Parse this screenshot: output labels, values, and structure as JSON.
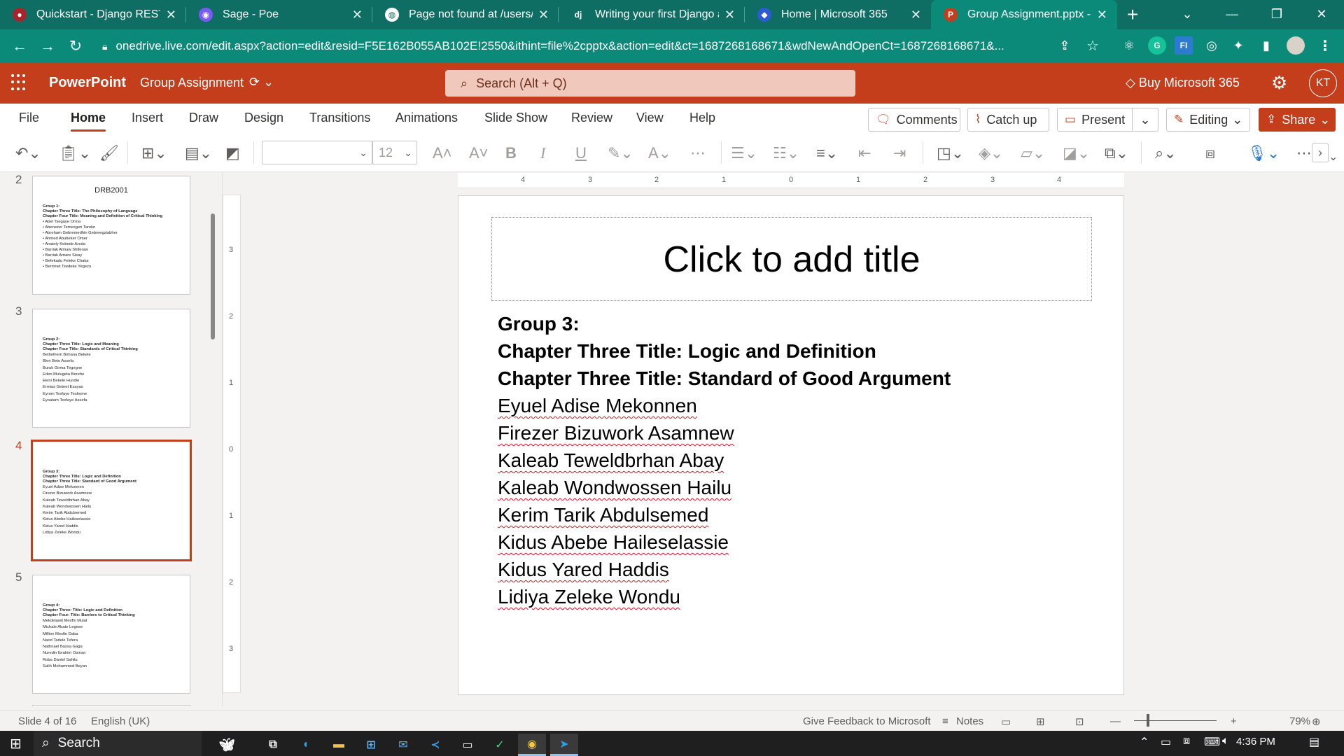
{
  "browser": {
    "tabs": [
      {
        "title": "Quickstart - Django REST fr",
        "favicon_color": "#a4262c",
        "favicon": "dj"
      },
      {
        "title": "Sage - Poe",
        "favicon_color": "#7a5af8",
        "favicon": "P"
      },
      {
        "title": "Page not found at /users/",
        "favicon_color": "#0f6e63",
        "favicon": "◍"
      },
      {
        "title": "Writing your first Django ap",
        "favicon_color": "#0c4b33",
        "favicon": "dj"
      },
      {
        "title": "Home | Microsoft 365",
        "favicon_color": "#2b5cd1",
        "favicon": "M"
      },
      {
        "title": "Group Assignment.pptx - M",
        "favicon_color": "#c43e1c",
        "favicon": "P"
      }
    ],
    "url": "onedrive.live.com/edit.aspx?action=edit&resid=F5E162B055AB102E!2550&ithint=file%2cpptx&action=edit&ct=1687268168671&wdNewAndOpenCt=1687268168671&..."
  },
  "office": {
    "app_name": "PowerPoint",
    "doc_name": "Group Assignment",
    "search_placeholder": "Search (Alt + Q)",
    "buy_label": "Buy Microsoft 365",
    "avatar_initials": "KT",
    "accent": "#c43e1c"
  },
  "ribbon": {
    "tabs": [
      "File",
      "Home",
      "Insert",
      "Draw",
      "Design",
      "Transitions",
      "Animations",
      "Slide Show",
      "Review",
      "View",
      "Help"
    ],
    "active_tab": "Home",
    "comments_label": "Comments",
    "catchup_label": "Catch up",
    "present_label": "Present",
    "editing_label": "Editing",
    "share_label": "Share",
    "font_size": "12"
  },
  "rulers": {
    "horizontal": [
      "4",
      "3",
      "2",
      "1",
      "0",
      "1",
      "2",
      "3",
      "4"
    ],
    "vertical": [
      "3",
      "2",
      "1",
      "0",
      "1",
      "2",
      "3"
    ]
  },
  "thumbnails": [
    {
      "number": "2",
      "title": "DRB2001",
      "bold_lines": [
        "Group 1:",
        "Chapter Three Title: The Philosophy of Language",
        "Chapter Four Title:  Meaning and Definition of Critical Thinking"
      ],
      "lines": [
        "•  Abel Tsegaye Orma",
        "•  Abenezer Temesgen Tarekn",
        "•  Abreham Gebremedhin Gebreegziabher",
        "•  Ahmed Abubeker Omer",
        "•  Anatoly Kebede Areda",
        "•  Barriak Almaw Shiferaw",
        "•  Barriak Amare Sisay",
        "•  Befekadu Feleke Chaka",
        "•  Bermnet Tsedeke Yegezu"
      ]
    },
    {
      "number": "3",
      "title": "",
      "bold_lines": [
        "Group 2:",
        "Chapter Three Title: Logic and Meaning",
        "Chapter Four Title: Standards of Critical Thinking"
      ],
      "lines": [
        "Bethelhem Birhanu Bekele",
        "Blen Beto Assefa",
        "Buruk Girma Tegegne",
        "Eden Mulugeta Berehe",
        "Eleni Bekele Hundie",
        "Ermias Getnet Esayas",
        "Eyrom Tesfaye Teshome",
        "Eyoatam Tesfaye Assefa"
      ]
    },
    {
      "number": "4",
      "title": "",
      "bold_lines": [
        "Group 3:",
        "Chapter Three Title: Logic and Definition",
        "Chapter Three Title: Standard of Good Argument"
      ],
      "lines": [
        "Eyuel Adise Mekonnen",
        "Firezer Bizuwork Asamnew",
        "Kaleab Teweldbrhan Abay",
        "Kaleab Wondwossen Hailu",
        "Kerim Tarik Abdulsemed",
        "Kidus Abebe Haileselassie",
        "Kidus Yared Haddis",
        "Lidiya Zeleke Wondu"
      ]
    },
    {
      "number": "5",
      "title": "",
      "bold_lines": [
        "Group 4:",
        "Chapter Three: Title: Logic and Definition",
        "Chapter Four:  Title: Barriers to Critical Thinking"
      ],
      "lines": [
        "Mekdelawit Mesfin Mulat",
        "Michale Abate Legese",
        "Million Mesfin Daba",
        "Naod Tadele Tefera",
        "Nathnael Bassa Gaga",
        "Nuredin Ibrahim Osman",
        "Roba Daniel Sahilu",
        "Salih Mohammed Beyan"
      ]
    }
  ],
  "slide": {
    "title_placeholder": "Click to add title",
    "bold_lines": [
      "Group 3:",
      "Chapter Three Title: Logic and Definition",
      "Chapter Three Title: Standard of Good Argument"
    ],
    "names": [
      "Eyuel Adise Mekonnen",
      "Firezer Bizuwork Asamnew",
      "Kaleab Teweldbrhan Abay",
      "Kaleab Wondwossen Hailu",
      "Kerim Tarik Abdulsemed",
      "Kidus Abebe Haileselassie",
      "Kidus Yared Haddis",
      "Lidiya Zeleke Wondu"
    ]
  },
  "status": {
    "slide_info": "Slide 4 of 16",
    "language": "English (UK)",
    "feedback": "Give Feedback to Microsoft",
    "notes": "Notes",
    "zoom": "79%"
  },
  "taskbar": {
    "search_label": "Search",
    "time": "4:36 PM"
  }
}
